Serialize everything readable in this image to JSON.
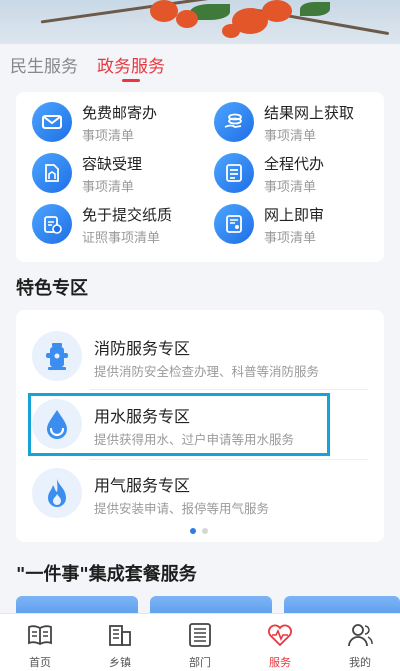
{
  "segment_tabs": [
    {
      "label": "民生服务",
      "active": false
    },
    {
      "label": "政务服务",
      "active": true
    }
  ],
  "services": [
    {
      "title": "免费邮寄办",
      "subtitle": "事项清单",
      "icon": "envelope-icon"
    },
    {
      "title": "结果网上获取",
      "subtitle": "事项清单",
      "icon": "hand-coins-icon"
    },
    {
      "title": "容缺受理",
      "subtitle": "事项清单",
      "icon": "document-building-icon"
    },
    {
      "title": "全程代办",
      "subtitle": "事项清单",
      "icon": "checklist-icon"
    },
    {
      "title": "免于提交纸质",
      "subtitle": "证照事项清单",
      "icon": "clipboard-clock-icon"
    },
    {
      "title": "网上即审",
      "subtitle": "事项清单",
      "icon": "document-user-icon"
    }
  ],
  "featured": {
    "title": "特色专区",
    "items": [
      {
        "title": "消防服务专区",
        "subtitle": "提供消防安全检查办理、科普等消防服务",
        "icon": "fire-hydrant-icon"
      },
      {
        "title": "用水服务专区",
        "subtitle": "提供获得用水、过户申请等用水服务",
        "icon": "water-drop-icon"
      },
      {
        "title": "用气服务专区",
        "subtitle": "提供安装申请、报停等用气服务",
        "icon": "flame-icon"
      }
    ],
    "carousel": {
      "page_count": 2,
      "active_index": 0
    }
  },
  "package": {
    "title": "\"一件事\"集成套餐服务"
  },
  "tabbar": [
    {
      "label": "首页",
      "icon": "book-icon",
      "active": false
    },
    {
      "label": "乡镇",
      "icon": "building-icon",
      "active": false
    },
    {
      "label": "部门",
      "icon": "list-panel-icon",
      "active": false
    },
    {
      "label": "服务",
      "icon": "heart-pulse-icon",
      "active": true
    },
    {
      "label": "我的",
      "icon": "user-icon",
      "active": false
    }
  ],
  "colors": {
    "accent": "#e8373f",
    "icon_blue": "#2a7de1",
    "highlight_border": "#17a3d8"
  }
}
